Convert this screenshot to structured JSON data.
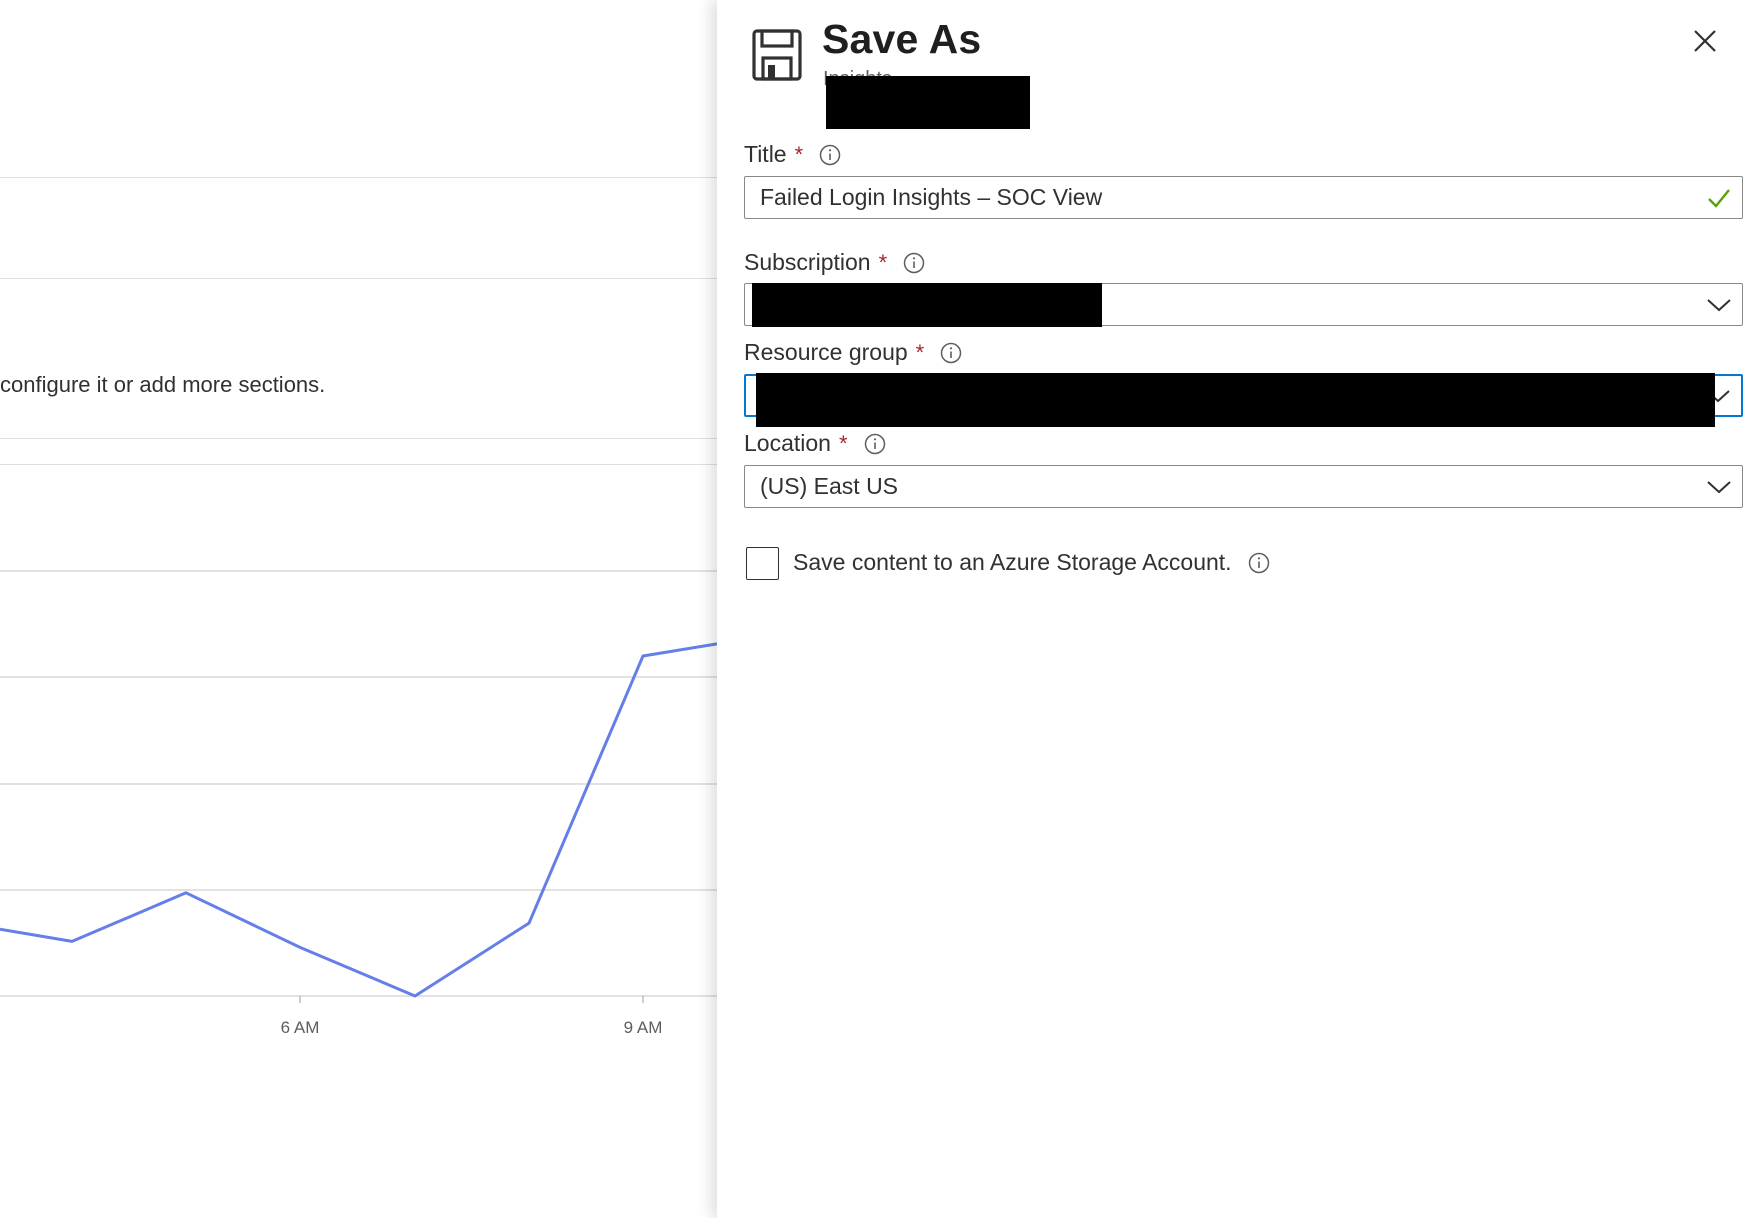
{
  "workbook": {
    "message": "configure it or add more sections."
  },
  "chart_data": {
    "type": "line",
    "title": "",
    "xlabel": "",
    "ylabel": "",
    "x_tick_labels": [
      "6 AM",
      "9 AM"
    ],
    "series": [
      {
        "color": "#6480e8",
        "points": [
          {
            "x": "≈03:30",
            "rel": 0.11
          },
          {
            "x": "≈04:00",
            "rel": 0.09
          },
          {
            "x": "≈05:00",
            "rel": 0.17
          },
          {
            "x": "≈06:00",
            "rel": 0.08
          },
          {
            "x": "≈07:00",
            "rel": 0.0
          },
          {
            "x": "≈08:00",
            "rel": 0.12
          },
          {
            "x": "≈09:00",
            "rel": 0.56
          },
          {
            "x": "≈09:40",
            "rel": 0.58
          }
        ]
      }
    ],
    "grid": true,
    "legend": "none"
  },
  "panel": {
    "title": "Save As",
    "subtitle": "Insights",
    "close_icon": "close-x-icon",
    "save_icon": "floppy-disk-icon",
    "fields": {
      "title": {
        "label": "Title",
        "required_mark": "*",
        "value": "Failed Login Insights – SOC View",
        "valid": true,
        "valid_color": "#57a300"
      },
      "subscription": {
        "label": "Subscription",
        "required_mark": "*",
        "value": ""
      },
      "resource_group": {
        "label": "Resource group",
        "required_mark": "*",
        "value": ""
      },
      "location": {
        "label": "Location",
        "required_mark": "*",
        "value": "(US) East US"
      }
    },
    "storage_option": {
      "label": "Save content to an Azure Storage Account.",
      "checked": false
    },
    "colors": {
      "accent": "#0078d4",
      "required": "#a4262c",
      "border": "#8a8886"
    }
  }
}
